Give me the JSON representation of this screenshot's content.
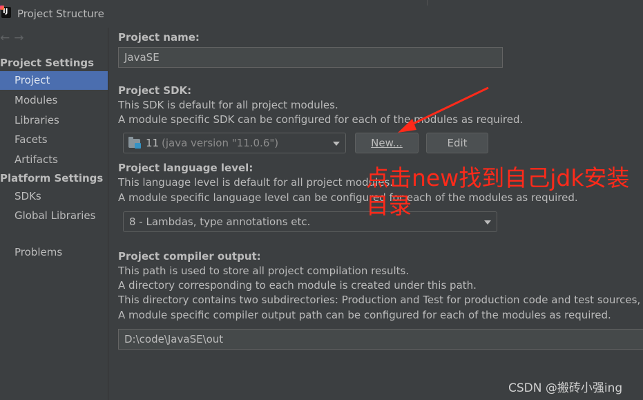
{
  "window": {
    "title": "Project Structure",
    "app_icon_text": "IJ"
  },
  "sidebar": {
    "back_arrow": "←",
    "forward_arrow": "→",
    "project_settings_header": "Project Settings",
    "project_settings_items": [
      "Project",
      "Modules",
      "Libraries",
      "Facets",
      "Artifacts"
    ],
    "selected_item": "Project",
    "platform_settings_header": "Platform Settings",
    "platform_settings_items": [
      "SDKs",
      "Global Libraries"
    ],
    "problems": "Problems"
  },
  "main": {
    "project_name_label": "Project name:",
    "project_name_value": "JavaSE",
    "sdk_label": "Project SDK:",
    "sdk_desc_1": "This SDK is default for all project modules.",
    "sdk_desc_2": "A module specific SDK can be configured for each of the modules as required.",
    "sdk_combo_version": "11",
    "sdk_combo_detail": "(java version \"11.0.6\")",
    "new_button": "New...",
    "edit_button": "Edit",
    "lang_label": "Project language level:",
    "lang_desc_1": "This language level is default for all project modules.",
    "lang_desc_2": "A module specific language level can be configured for each of the modules as required.",
    "lang_combo_value": "8 - Lambdas, type annotations etc.",
    "output_label": "Project compiler output:",
    "output_desc_1": "This path is used to store all project compilation results.",
    "output_desc_2": "A directory corresponding to each module is created under this path.",
    "output_desc_3": "This directory contains two subdirectories: Production and Test for production code and test sources, res",
    "output_desc_4": "A module specific compiler output path can be configured for each of the modules as required.",
    "output_value": "D:\\code\\JavaSE\\out"
  },
  "annotation": {
    "text": "点击new找到自己jdk安装目录",
    "color": "#ff2a1a"
  },
  "watermark": "CSDN @搬砖小强ing",
  "colors": {
    "background": "#3c3f41",
    "selection": "#4b6eaf",
    "text": "#bbbbbb"
  }
}
